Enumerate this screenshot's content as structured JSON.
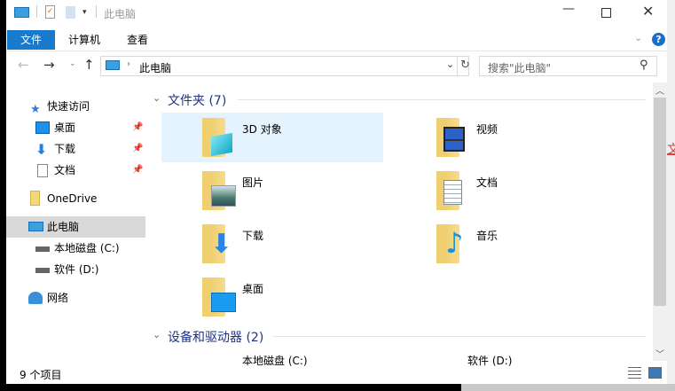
{
  "window": {
    "title": "此电脑"
  },
  "ribbon": {
    "tabs": [
      "文件",
      "计算机",
      "查看"
    ]
  },
  "address": {
    "path": "此电脑",
    "search_placeholder": "搜索\"此电脑\""
  },
  "sidebar": {
    "items": [
      {
        "label": "快速访问",
        "icon": "star-icon"
      },
      {
        "label": "桌面",
        "icon": "desktop-icon",
        "pinned": true
      },
      {
        "label": "下载",
        "icon": "download-icon",
        "pinned": true
      },
      {
        "label": "文档",
        "icon": "document-icon",
        "pinned": true
      },
      {
        "label": "OneDrive",
        "icon": "folder-icon"
      },
      {
        "label": "此电脑",
        "icon": "computer-icon",
        "selected": true
      },
      {
        "label": "本地磁盘 (C:)",
        "icon": "drive-icon"
      },
      {
        "label": "软件 (D:)",
        "icon": "drive-icon"
      },
      {
        "label": "网络",
        "icon": "network-icon"
      }
    ]
  },
  "main": {
    "folders_header": "文件夹 (7)",
    "folders": [
      {
        "label": "3D 对象",
        "icon": "3d-objects-icon",
        "selected": true
      },
      {
        "label": "视频",
        "icon": "videos-icon"
      },
      {
        "label": "图片",
        "icon": "pictures-icon"
      },
      {
        "label": "文档",
        "icon": "documents-icon"
      },
      {
        "label": "下载",
        "icon": "downloads-icon"
      },
      {
        "label": "音乐",
        "icon": "music-icon"
      },
      {
        "label": "桌面",
        "icon": "desktop-icon"
      }
    ],
    "devices_header": "设备和驱动器 (2)",
    "devices": [
      {
        "label": "本地磁盘 (C:)"
      },
      {
        "label": "软件 (D:)"
      }
    ]
  },
  "status": {
    "items_count": "9 个项目"
  },
  "background": {
    "partial_text": "文"
  }
}
